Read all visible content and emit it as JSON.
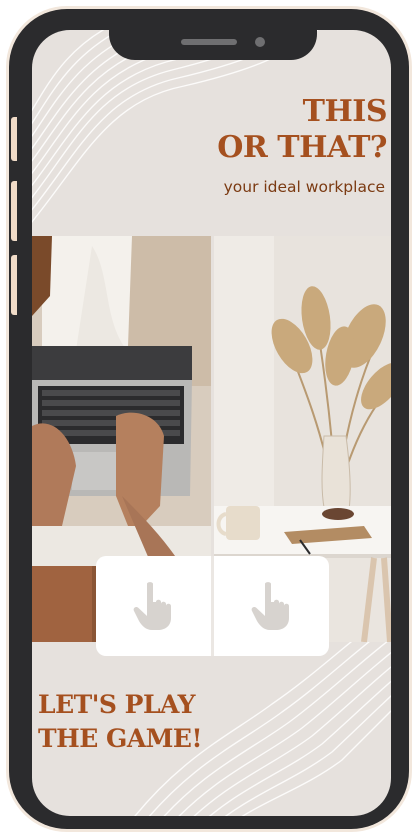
{
  "header": {
    "title_line1": "THIS",
    "title_line2": "OR THAT?",
    "subtitle": "your ideal workplace"
  },
  "options": [
    {
      "name": "laptop-on-lap-photo"
    },
    {
      "name": "desk-with-pampas-vase-photo"
    }
  ],
  "vote": {
    "left_icon": "pointing-hand-icon",
    "right_icon": "pointing-hand-icon"
  },
  "footer": {
    "cta_line1": "LET'S PLAY",
    "cta_line2": "THE GAME!"
  },
  "colors": {
    "accent": "#a5501f",
    "subtitle": "#7b3a12",
    "screen_bg": "#e6e1dd",
    "phone_frame": "#2b2b2d",
    "hand_icon": "#d7d3cf"
  }
}
